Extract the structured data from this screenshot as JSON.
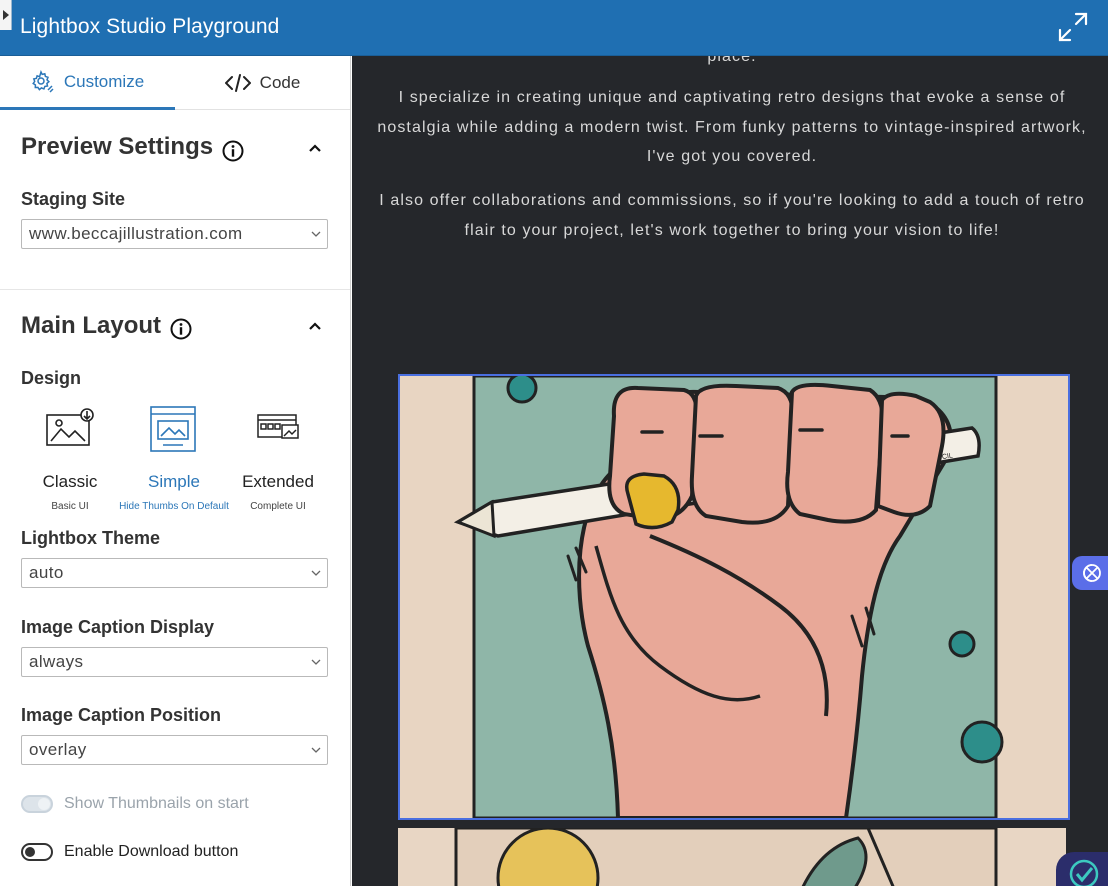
{
  "header": {
    "title": "Lightbox Studio Playground",
    "expand_icon": "expand-icon",
    "collapse_icon": "caret-right-icon"
  },
  "tabs": [
    {
      "label": "Customize",
      "icon": "gear-brush-icon",
      "active": true
    },
    {
      "label": "Code",
      "icon": "code-icon",
      "active": false
    }
  ],
  "preview_settings": {
    "title": "Preview Settings",
    "staging_label": "Staging Site",
    "staging_value": "www.beccajillustration.com"
  },
  "main_layout": {
    "title": "Main Layout",
    "design_label": "Design",
    "designs": [
      {
        "name": "Classic",
        "sub": "Basic UI",
        "selected": false
      },
      {
        "name": "Simple",
        "sub": "Hide Thumbs On Default",
        "selected": true
      },
      {
        "name": "Extended",
        "sub": "Complete UI",
        "selected": false
      }
    ],
    "theme_label": "Lightbox Theme",
    "theme_value": "auto",
    "caption_display_label": "Image Caption Display",
    "caption_display_value": "always",
    "caption_position_label": "Image Caption Position",
    "caption_position_value": "overlay",
    "thumbnails_label": "Show Thumbnails on start",
    "thumbnails_on": true,
    "download_label": "Enable Download button",
    "download_on": false
  },
  "preview": {
    "partial_text": "place.",
    "paragraph1": "I specialize in creating unique and captivating retro designs that evoke a sense of nostalgia while adding a modern twist. From funky patterns to vintage-inspired artwork, I've got you covered.",
    "paragraph2": "I also offer collaborations and commissions, so if you're looking to add a touch of retro flair to your project, let's work together to bring your vision to life!",
    "pencil_text": "PENCIL"
  },
  "colors": {
    "header_bg": "#1f6fb2",
    "accent": "#2c77b8",
    "preview_bg": "#25272b",
    "selection_border": "#4a6fe0"
  }
}
